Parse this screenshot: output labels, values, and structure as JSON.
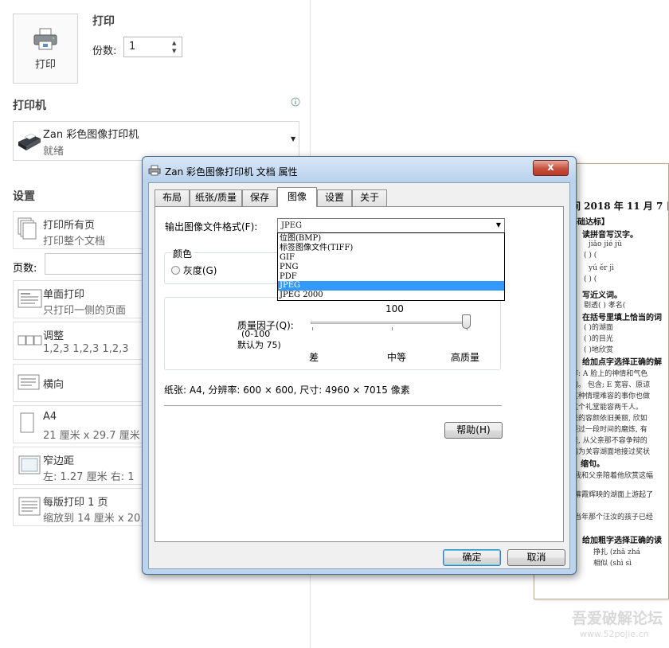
{
  "print": {
    "section_title": "打印",
    "button_label": "打印",
    "copies_label": "份数:",
    "copies_value": "1"
  },
  "printer": {
    "section_title": "打印机",
    "name": "Zan 彩色图像打印机",
    "status": "就绪"
  },
  "settings": {
    "section_title": "设置",
    "pages_label": "页数:",
    "items": [
      {
        "title": "打印所有页",
        "subtitle": "打印整个文档"
      },
      {
        "title": "单面打印",
        "subtitle": "只打印一侧的页面"
      },
      {
        "title": "调整",
        "subtitle": "1,2,3    1,2,3    1,2,3"
      },
      {
        "title": "横向",
        "subtitle": ""
      },
      {
        "title": "A4",
        "subtitle": "21 厘米 x 29.7 厘米"
      },
      {
        "title": "窄边距",
        "subtitle": "左: 1.27 厘米    右: 1"
      },
      {
        "title": "每版打印 1 页",
        "subtitle": "缩放到 14 厘米 x 20.3"
      }
    ]
  },
  "preview": {
    "lines": [
      "间 2018 年 11 月 7 日",
      "基础达标】",
      "读拼音写汉字。",
      "jiǎo  jié    jū",
      "(       )    (",
      "yú    ěr     jì",
      "(       )    (",
      "写近义词。",
      "剔透(     )  孝名(",
      "在括号里填上恰当的词",
      "(       )的湖面",
      "(       )的目光",
      "(       )地欣赏",
      "给加点字选择正确的解",
      "容: A 脸上的神情和气色",
      "的。 包含; E 宽容、原谅",
      "这种情理难容的事你也做",
      "这个礼堂能容两千人。",
      "是的容颜依旧美丽, 欣如",
      "经过一段时间的磨炼, 有",
      "是, 从父亲那不容争辩的",
      "满为关容湖面地接过奖状",
      "缩句。",
      "我和父亲陪着他欣赏这幅",
      "幕霞辉映的湖面上游起了",
      "当年那个汪汝的孩子已经",
      "给加粗字选择正确的读",
      "挣扎 (zhā  zhá",
      "相似 (shì   sì"
    ]
  },
  "dialog": {
    "title": "Zan 彩色图像打印机 文档 属性",
    "close_symbol": "x",
    "tabs": [
      "布局",
      "纸张/质量",
      "保存",
      "图像",
      "设置",
      "关于"
    ],
    "format_label": "输出图像文件格式(F):",
    "format_value": "JPEG",
    "format_options": [
      "位图(BMP)",
      "标签图像文件(TIFF)",
      "GIF",
      "PNG",
      "PDF",
      "JPEG",
      "JPEG 2000"
    ],
    "color_group_label": "颜色",
    "grayscale_label": "灰度(G)",
    "quality_value": "100",
    "quality_label": "质量因子(Q):",
    "quality_range": "(0-100",
    "quality_default": "默认为 75)",
    "quality_low": "差",
    "quality_mid": "中等",
    "quality_high": "高质量",
    "info_text": "纸张: A4, 分辨率: 600 × 600, 尺寸: 4960 × 7015 像素",
    "help_button": "帮助(H)",
    "ok_button": "确定",
    "cancel_button": "取消"
  },
  "watermark": {
    "text": "吾爱破解论坛",
    "url": "www.52pojie.cn"
  }
}
